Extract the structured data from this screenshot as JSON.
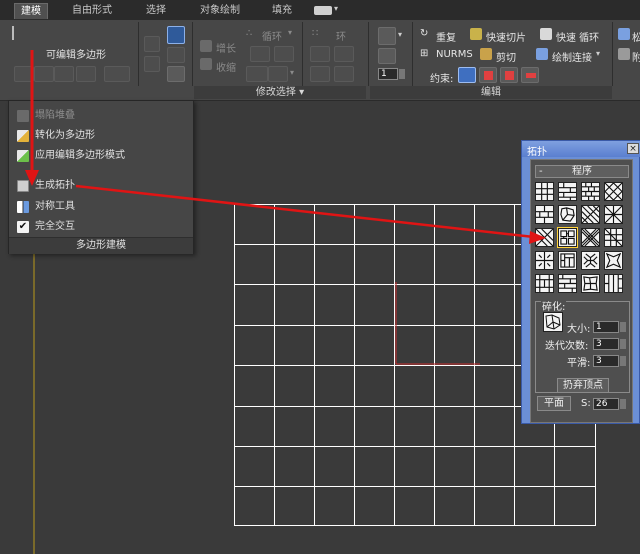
{
  "tabs": [
    "建模",
    "自由形式",
    "选择",
    "对象绘制",
    "填充"
  ],
  "ribbon": {
    "editable_poly": "可编辑多边形",
    "grow": "增长",
    "shrink": "收缩",
    "loop": "循环",
    "ring": "环",
    "modify_selection_footer": "修改选择",
    "repeat": "重复",
    "quickslice": "快速切片",
    "quickloop": "快速 循环",
    "nurms": "NURMS",
    "cut": "剪切",
    "paint_connect": "绘制连接",
    "constraints": "约束:",
    "spinner_value": "1",
    "edit_footer": "编辑",
    "right_edge_label_1": "松",
    "right_edge_label_2": "附"
  },
  "dropdown": {
    "items": [
      {
        "label": "塌陷堆叠",
        "icon": "collapse-stack-icon"
      },
      {
        "label": "转化为多边形",
        "icon": "convert-to-poly-icon"
      },
      {
        "label": "应用编辑多边形模式",
        "icon": "apply-edit-poly-icon"
      },
      {
        "label": "生成拓扑",
        "icon": "generate-topology-icon"
      },
      {
        "label": "对称工具",
        "icon": "symmetry-tool-icon"
      },
      {
        "label": "完全交互",
        "icon": "checkbox-icon"
      }
    ],
    "footer": "多边形建模"
  },
  "dialog": {
    "title": "拓扑",
    "close": "×",
    "rollout_minus": "-",
    "procedure_label": "程序",
    "subdivide_label": "碎化:",
    "size_label": "大小:",
    "size_value": "1",
    "iterations_label": "迭代次数:",
    "iterations_value": "3",
    "smooth_label": "平滑:",
    "smooth_value": "3",
    "drop_vertices": "扔弃顶点",
    "plane": "平面",
    "s_label": "S:",
    "s_value": "26"
  },
  "colors": {
    "arrow": "#e01414",
    "dialog_bg": "#6b8fd6",
    "grid_line": "#ffffff",
    "viewport_bg": "#3a3a3a"
  }
}
